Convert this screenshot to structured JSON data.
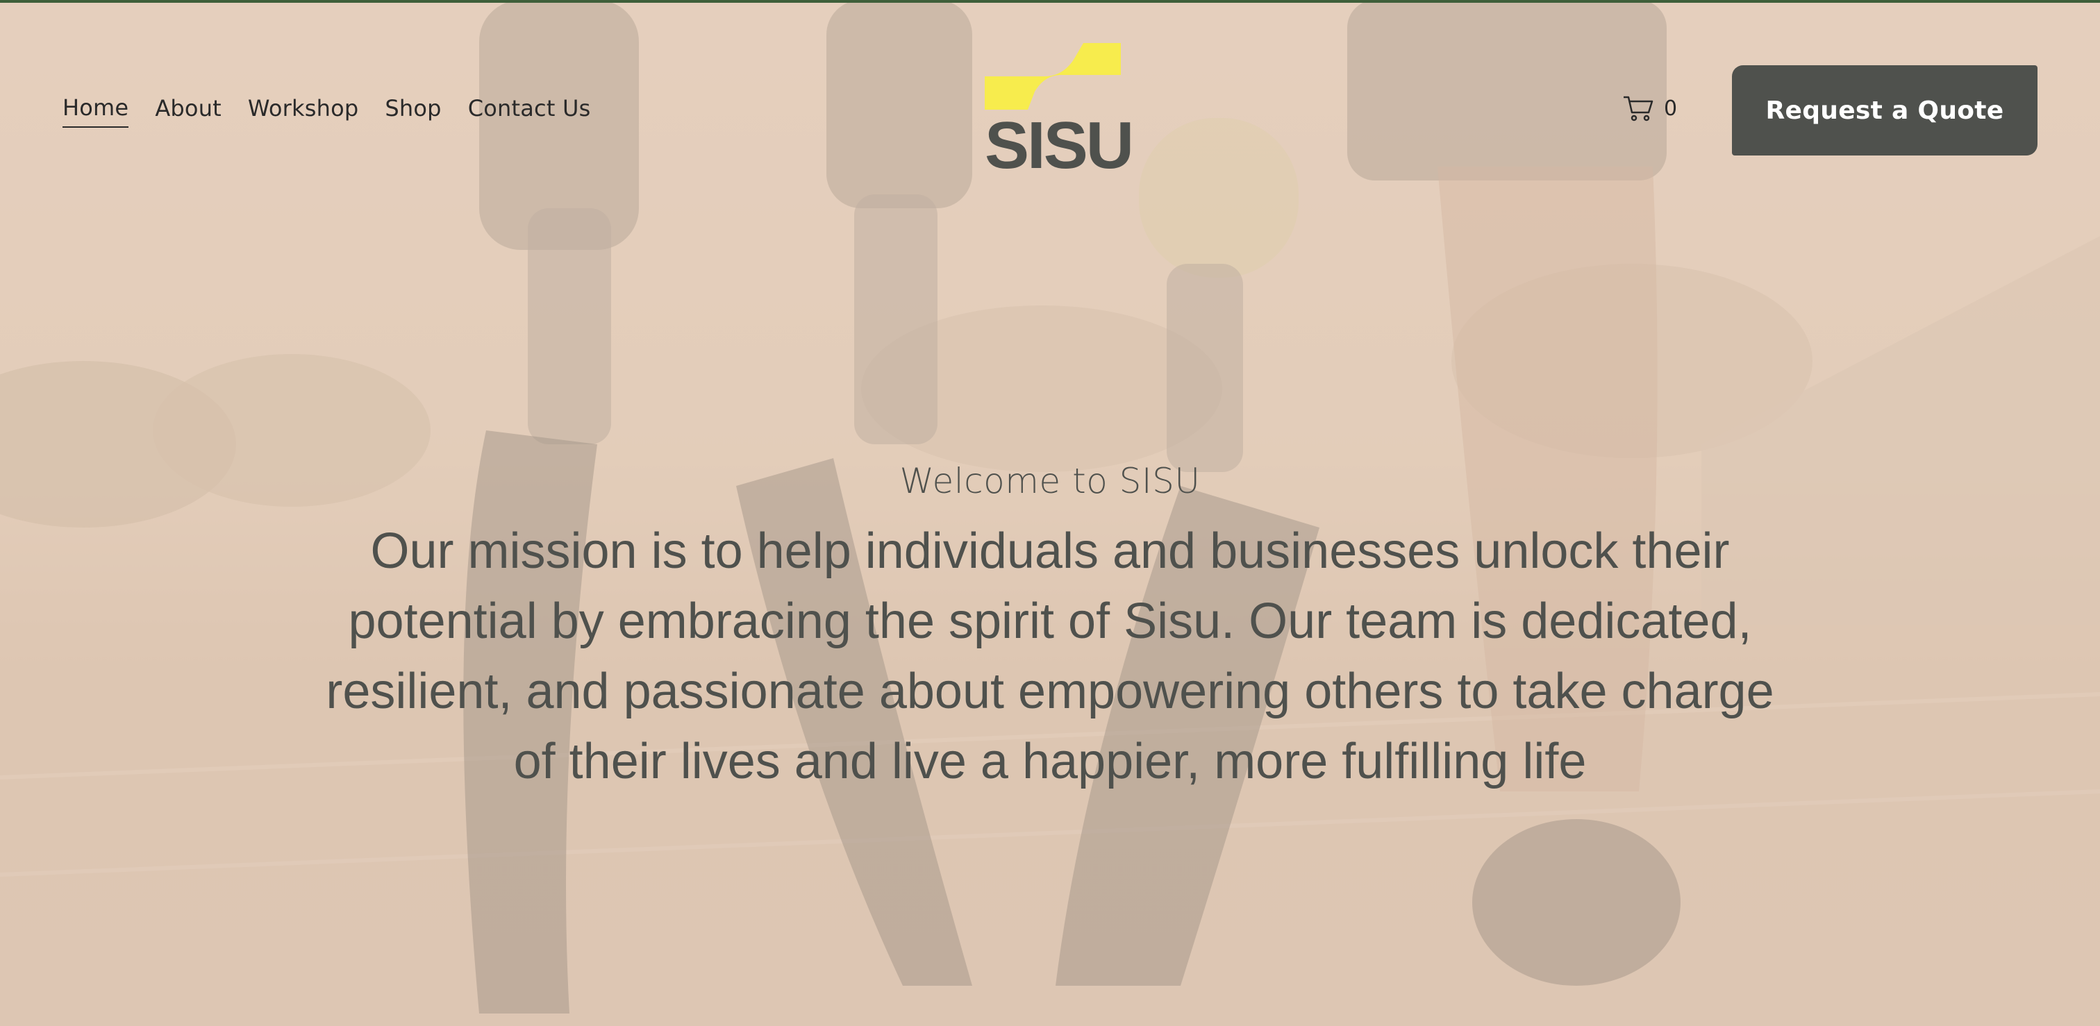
{
  "nav": {
    "items": [
      {
        "label": "Home",
        "active": true
      },
      {
        "label": "About",
        "active": false
      },
      {
        "label": "Workshop",
        "active": false
      },
      {
        "label": "Shop",
        "active": false
      },
      {
        "label": "Contact Us",
        "active": false
      }
    ]
  },
  "logo": {
    "text": "SISU",
    "icon": "sisu-swoosh-logo-icon",
    "accent_color": "#f7ec4d",
    "text_color": "#4f514d"
  },
  "cart": {
    "icon": "shopping-cart-icon",
    "count": "0"
  },
  "cta": {
    "label": "Request a Quote",
    "background": "#4f514d"
  },
  "hero": {
    "welcome": "Welcome to SISU",
    "mission": "Our mission is to help individuals and businesses unlock their potential by embracing the spirit of Sisu. Our team is dedicated, resilient, and passionate about empowering others to take charge of their lives and live a happier, more fulfilling life",
    "background_image": "prosthetic-running-blades-on-track-photo",
    "overlay_color": "#e6d3c1"
  },
  "theme": {
    "top_rule_color": "#3e5f3a",
    "text_color": "#4f514d"
  }
}
